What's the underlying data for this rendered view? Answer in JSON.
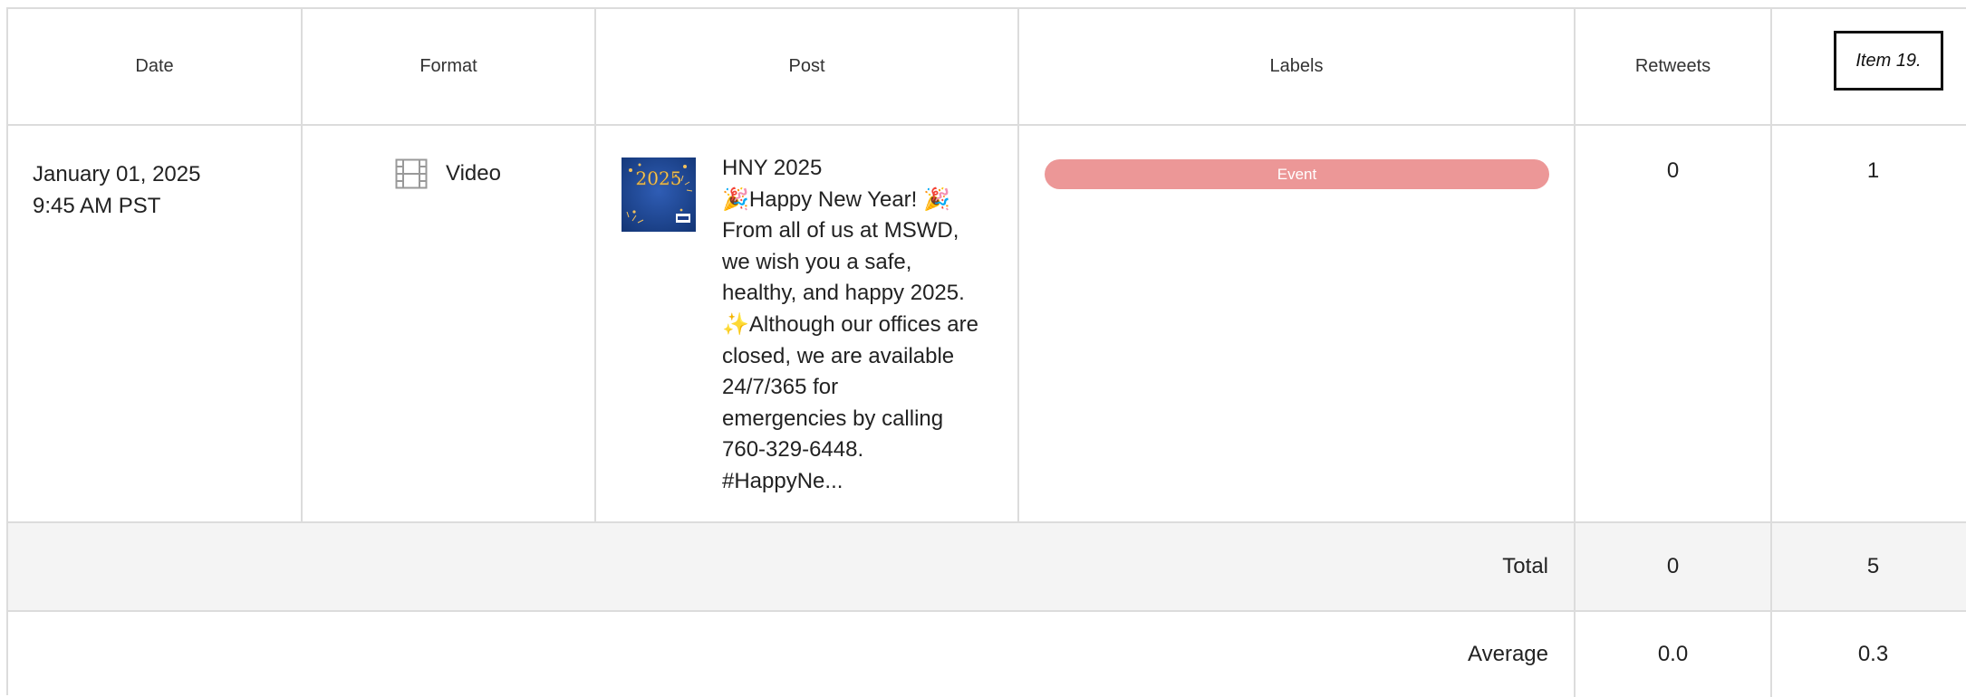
{
  "columns": {
    "date": "Date",
    "format": "Format",
    "post": "Post",
    "labels": "Labels",
    "retweets": "Retweets"
  },
  "item_tag": "Item 19.",
  "rows": [
    {
      "date_line1": "January 01, 2025",
      "date_line2": "9:45 AM PST",
      "format": "Video",
      "format_icon": "film-icon",
      "post_text": "HNY 2025\n🎉Happy New Year! 🎉\nFrom all of us at MSWD,\nwe wish you a safe,\nhealthy, and happy 2025.\n✨Although our offices are\nclosed, we are available\n24/7/365 for\nemergencies by calling\n760-329-6448.\n#HappyNe...",
      "thumbnail_text": "2025",
      "label": "Event",
      "label_color": "#ec9797",
      "retweets": "0",
      "last_value": "1"
    }
  ],
  "total": {
    "label": "Total",
    "retweets": "0",
    "last_value": "5"
  },
  "average": {
    "label": "Average",
    "retweets": "0.0",
    "last_value": "0.3"
  }
}
